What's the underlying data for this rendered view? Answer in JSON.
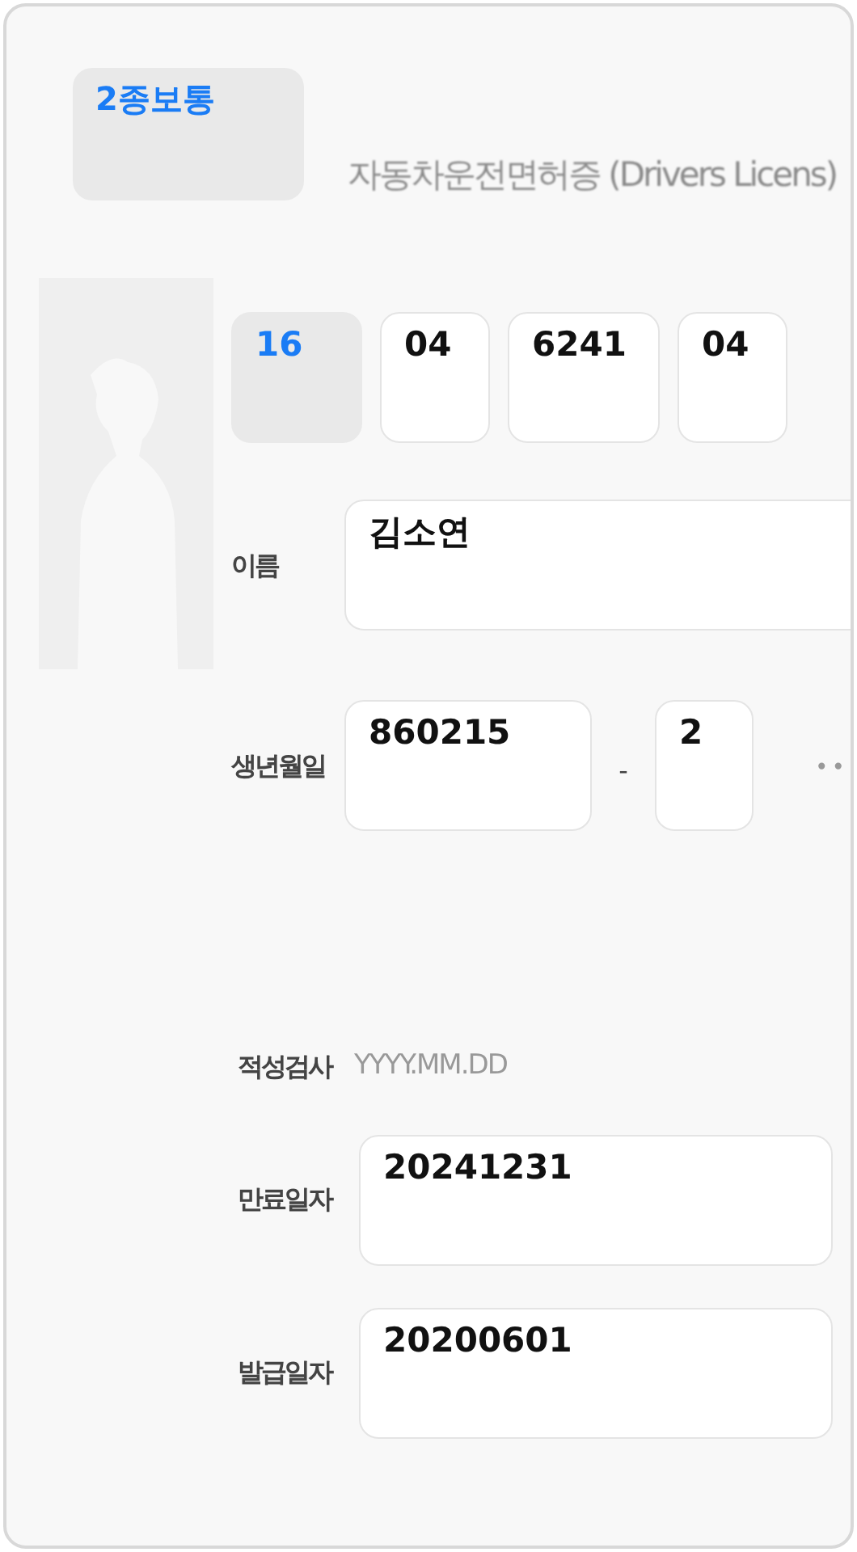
{
  "license_type": {
    "value": "2종보통"
  },
  "title": "자동차운전면허증 (Drivers Licens)",
  "license_number": [
    {
      "value": "16",
      "kind": "select"
    },
    {
      "value": "04",
      "kind": "input"
    },
    {
      "value": "6241",
      "kind": "input"
    },
    {
      "value": "04",
      "kind": "input"
    }
  ],
  "name": {
    "label": "이름",
    "value": "김소연"
  },
  "birth": {
    "label": "생년월일",
    "value": "860215",
    "separator": "-",
    "gender_digit": "2",
    "masked": "••"
  },
  "aptitude_test": {
    "label": "적성검사",
    "placeholder": "YYYY.MM.DD"
  },
  "dates": [
    {
      "label": "만료일자",
      "value": "20241231"
    },
    {
      "label": "발급일자",
      "value": "20200601"
    }
  ]
}
